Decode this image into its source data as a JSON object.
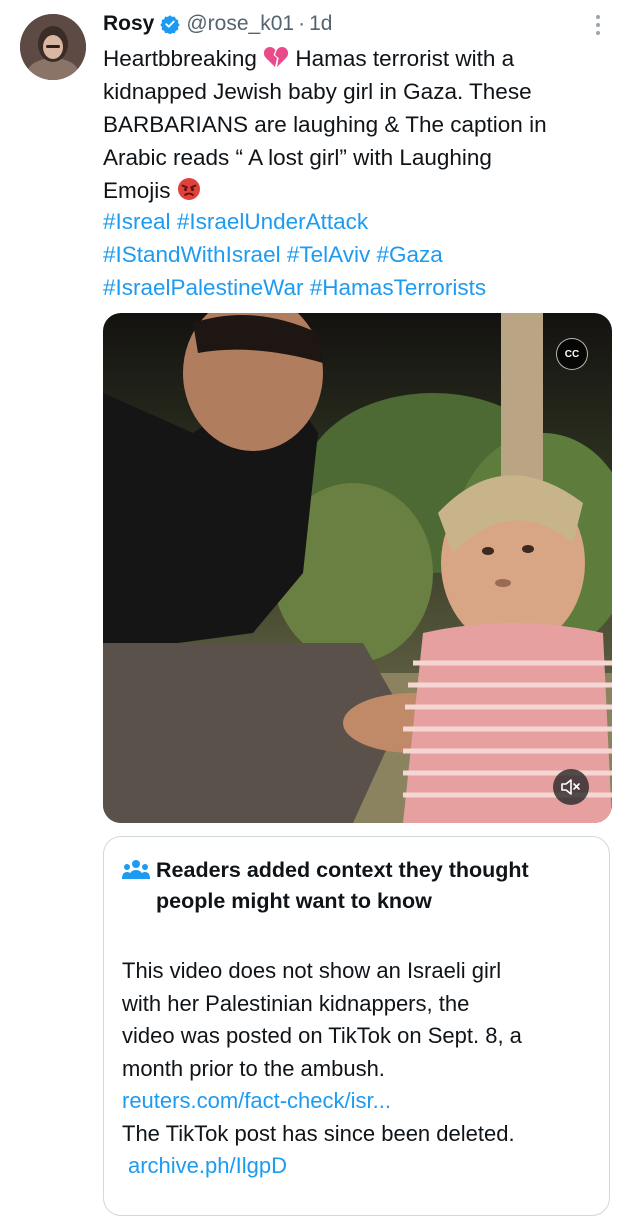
{
  "tweet": {
    "name": "Rosy",
    "handle": "@rose_k01",
    "separator": "·",
    "time": "1d",
    "text_lines": [
      "Heartbbreaking",
      "Hamas terrorist with a",
      "kidnapped Jewish baby girl in Gaza.   These",
      "BARBARIANS are laughing & The caption in",
      "Arabic reads “ A lost girl” with Laughing",
      "Emojis"
    ],
    "hashtag_lines": [
      [
        "#Isreal",
        "#IsraelUnderAttack"
      ],
      [
        "#IStandWithIsrael",
        "#TelAviv",
        "#Gaza"
      ],
      [
        "#IsraelPalestineWar",
        "#HamasTerrorists"
      ]
    ],
    "media": {
      "cc_label": "CC",
      "mute_icon": "speaker-muted-icon"
    }
  },
  "community_note": {
    "title_lines": [
      "Readers added context they thought",
      "people might want to know"
    ],
    "body_lines": [
      "This video does not show an Israeli girl",
      "with her Palestinian kidnappers, the",
      "video was posted on TikTok on Sept. 8, a",
      "month prior to the ambush."
    ],
    "link1": "reuters.com/fact-check/isr...",
    "body_after": "The TikTok post has since been deleted.",
    "link2": "archive.ph/IlgpD"
  },
  "colors": {
    "link": "#1d9bf0",
    "secondary_text": "#536471",
    "border": "#cfd9de",
    "verified": "#1d9bf0"
  }
}
